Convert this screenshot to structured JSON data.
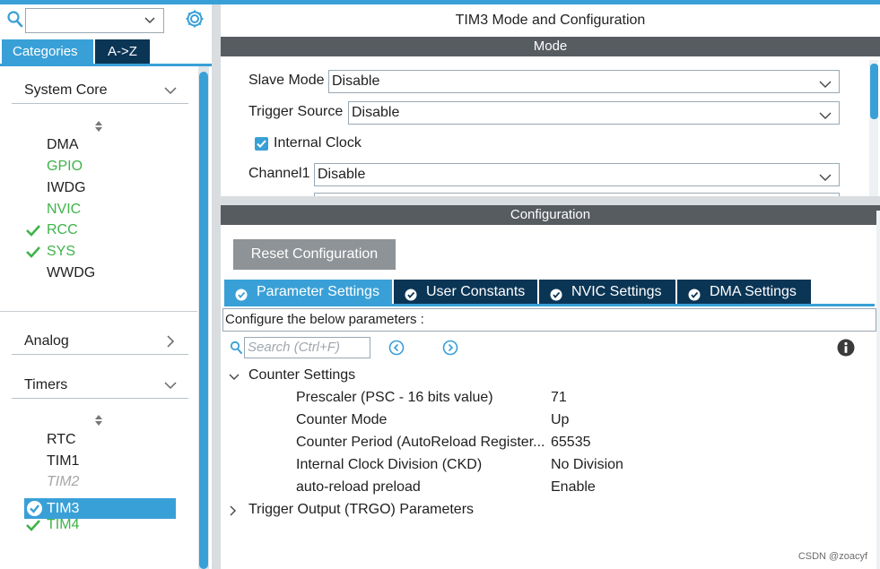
{
  "left_panel": {
    "search": {
      "value": "",
      "placeholder": ""
    },
    "tabs": [
      {
        "label": "Categories",
        "active": true
      },
      {
        "label": "A->Z",
        "active": false
      }
    ],
    "sections": {
      "system_core": {
        "label": "System Core",
        "items": [
          {
            "label": "DMA",
            "state": "default",
            "checked": false
          },
          {
            "label": "GPIO",
            "state": "configured",
            "checked": false
          },
          {
            "label": "IWDG",
            "state": "default",
            "checked": false
          },
          {
            "label": "NVIC",
            "state": "configured",
            "checked": false
          },
          {
            "label": "RCC",
            "state": "configured",
            "checked": true
          },
          {
            "label": "SYS",
            "state": "configured",
            "checked": true
          },
          {
            "label": "WWDG",
            "state": "default",
            "checked": false
          }
        ]
      },
      "analog": {
        "label": "Analog"
      },
      "timers": {
        "label": "Timers",
        "items": [
          {
            "label": "RTC",
            "state": "default",
            "checked": false
          },
          {
            "label": "TIM1",
            "state": "default",
            "checked": false
          },
          {
            "label": "TIM2",
            "state": "disabled",
            "checked": false
          },
          {
            "label": "TIM3",
            "state": "selected",
            "checked": true
          },
          {
            "label": "TIM4",
            "state": "configured",
            "checked": true
          }
        ]
      }
    }
  },
  "main": {
    "title": "TIM3 Mode and Configuration",
    "mode": {
      "bar_label": "Mode",
      "slave_mode": {
        "label": "Slave Mode",
        "value": "Disable"
      },
      "trigger_source": {
        "label": "Trigger Source",
        "value": "Disable"
      },
      "internal_clock": {
        "label": "Internal Clock",
        "checked": true
      },
      "channel1": {
        "label": "Channel1",
        "value": "Disable"
      }
    },
    "configuration": {
      "bar_label": "Configuration",
      "reset_label": "Reset Configuration",
      "tabs": [
        {
          "label": "Parameter Settings",
          "active": true
        },
        {
          "label": "User Constants",
          "active": false
        },
        {
          "label": "NVIC Settings",
          "active": false
        },
        {
          "label": "DMA Settings",
          "active": false
        }
      ],
      "description": "Configure the below parameters :",
      "search_placeholder": "Search (Ctrl+F)",
      "groups": [
        {
          "name": "Counter Settings",
          "expanded": true,
          "params": [
            {
              "name": "Prescaler (PSC - 16 bits value)",
              "value": "71"
            },
            {
              "name": "Counter Mode",
              "value": "Up"
            },
            {
              "name": "Counter Period (AutoReload Register...",
              "value": "65535"
            },
            {
              "name": "Internal Clock Division (CKD)",
              "value": "No Division"
            },
            {
              "name": "auto-reload preload",
              "value": "Enable"
            }
          ]
        },
        {
          "name": "Trigger Output (TRGO) Parameters",
          "expanded": false
        }
      ]
    }
  },
  "watermark": "CSDN @zoacyf",
  "colors": {
    "accent": "#39a0d7",
    "dark_tab": "#0b3555",
    "bar": "#575c61",
    "configured_green": "#3fb34a",
    "disabled_gray": "#a6a6a6"
  }
}
